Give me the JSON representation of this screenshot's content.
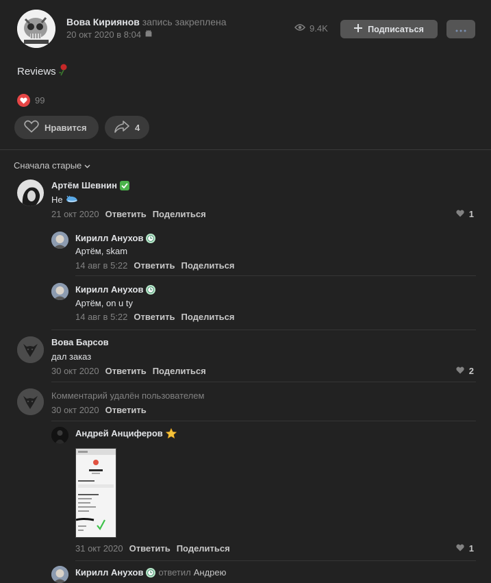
{
  "post": {
    "author": "Вова Кириянов",
    "pinned_note": "запись закреплена",
    "date": "20 окт 2020 в 8:04",
    "views": "9.4K",
    "subscribe_label": "Подписаться",
    "text": "Reviews",
    "reaction_count": "99",
    "like_label": "Нравится",
    "share_count": "4"
  },
  "comments_sort": "Сначала старые",
  "comments": [
    {
      "author": "Артём Шевнин",
      "badge": "check-mark-emoji",
      "text": "Не",
      "emoji": "whale-emoji",
      "date": "21 окт 2020",
      "reply": "Ответить",
      "share": "Поделиться",
      "likes": "1"
    },
    {
      "author": "Кирилл Анухов",
      "badge": "clock-emoji",
      "text": "Артём, skam",
      "date": "14 авг в 5:22",
      "reply": "Ответить",
      "share": "Поделиться"
    },
    {
      "author": "Кирилл Анухов",
      "badge": "clock-emoji",
      "text": "Артём, on u ty",
      "date": "14 авг в 5:22",
      "reply": "Ответить",
      "share": "Поделиться"
    },
    {
      "author": "Вова Барсов",
      "text": "дал заказ",
      "date": "30 окт 2020",
      "reply": "Ответить",
      "share": "Поделиться",
      "likes": "2"
    },
    {
      "deleted_text": "Комментарий удалён пользователем",
      "date": "30 окт 2020",
      "reply": "Ответить"
    },
    {
      "author": "Андрей Анциферов",
      "badge": "star-emoji",
      "date": "31 окт 2020",
      "reply": "Ответить",
      "share": "Поделиться",
      "likes": "1"
    },
    {
      "author": "Кирилл Анухов",
      "badge": "clock-emoji",
      "replied_to_label": "ответил",
      "replied_to": "Андрею"
    }
  ],
  "colors": {
    "background": "#222222",
    "button": "#555555",
    "pill": "#3a3a3a",
    "heart": "#e64646",
    "text": "#e1e3e6",
    "muted": "#828282"
  }
}
